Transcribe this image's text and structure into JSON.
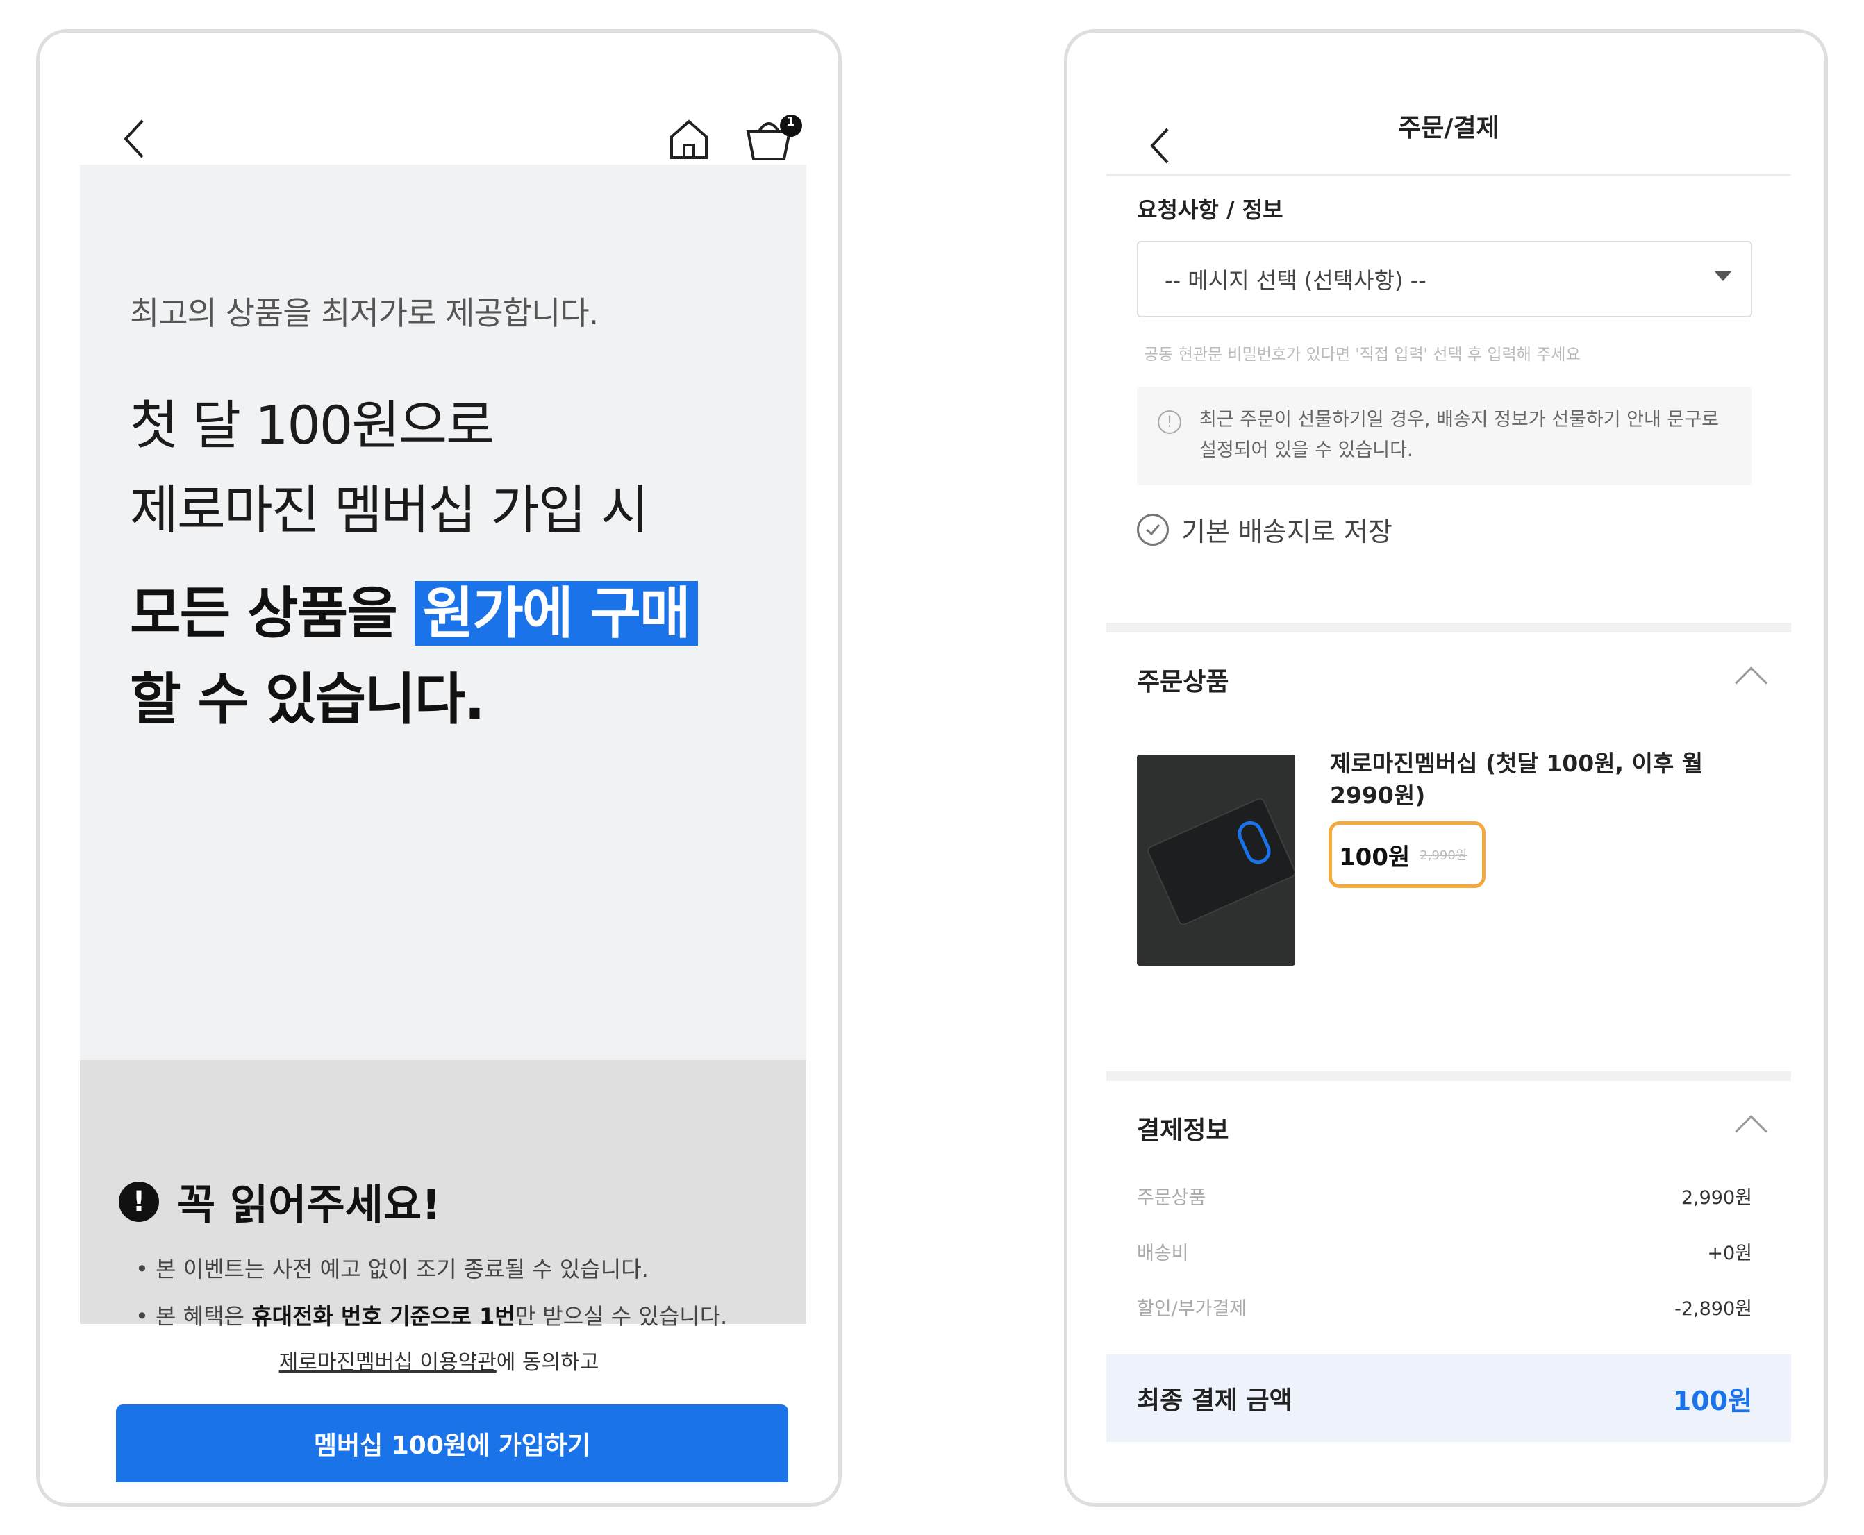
{
  "colors": {
    "accent": "#1a73e8",
    "highlight_border": "#f3a93d",
    "hero_bg": "#f1f2f4",
    "notice_bg": "#dfdfdf"
  },
  "left": {
    "cart_badge": "1",
    "hero": {
      "subtitle": "최고의 상품을 최저가로 제공합니다.",
      "line1": "첫 달 100원으로",
      "line2": "제로마진 멤버십 가입 시",
      "line3_pre": "모든 상품을 ",
      "line3_highlight": "원가에 구매",
      "line4": "할 수 있습니다."
    },
    "notice": {
      "icon": "!",
      "title": "꼭 읽어주세요!",
      "bullet1": "• 본 이벤트는 사전 예고 없이 조기 종료될 수 있습니다.",
      "bullet2_pre": "• 본 혜택은 ",
      "bullet2_bold": "휴대전화 번호 기준으로 1번",
      "bullet2_post": "만 받으실 수 있습니다."
    },
    "terms_link": "제로마진멤버십 이용약관",
    "terms_suffix": "에 동의하고",
    "join_button": "멤버십 100원에 가입하기"
  },
  "right": {
    "title": "주문/결제",
    "request_section": "요청사항 / 정보",
    "message_select": "-- 메시지 선택 (선택사항) --",
    "hint": "공동 현관문 비밀번호가 있다면 '직접 입력' 선택 후 입력해 주세요",
    "info_icon": "!",
    "info_line1": "최근 주문이 선물하기일 경우, 배송지 정보가 선물하기 안내 문구로",
    "info_line2": "설정되어 있을 수 있습니다.",
    "save_default": "기본 배송지로 저장",
    "order_section": "주문상품",
    "product_name": "제로마진멤버십 (첫달 100원, 이후 월 2990원)",
    "price_now": "100원",
    "price_old": "2,990원",
    "payment_section": "결제정보",
    "payment_rows": [
      {
        "label": "주문상품",
        "value": "2,990원"
      },
      {
        "label": "배송비",
        "value": "+0원"
      },
      {
        "label": "할인/부가결제",
        "value": "-2,890원"
      }
    ],
    "total_label": "최종 결제 금액",
    "total_value": "100원"
  }
}
